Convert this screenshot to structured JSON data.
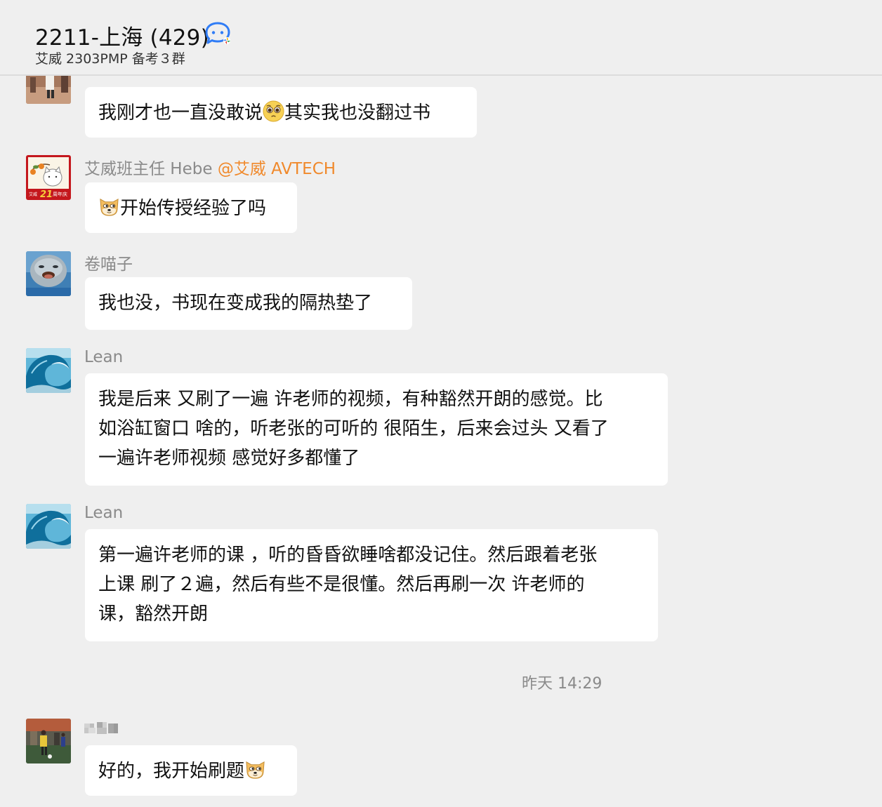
{
  "header": {
    "title": "2211-上海 (429)",
    "subtitle": "艾威 2303PMP 备考３群",
    "group_icon": "chat-bubbles-icon"
  },
  "messages": [
    {
      "sender": "",
      "text_parts": [
        "我刚才也一直没敢说",
        "其实我也没翻过书"
      ],
      "emoji": "pleading-face-icon",
      "avatar": "photo-avatar-person"
    },
    {
      "sender": "艾威班主任 Hebe",
      "mention": "@艾威 AVTECH",
      "text_parts": [
        "",
        "开始传授经验了吗"
      ],
      "emoji": "doge-icon",
      "avatar": "avtech-anniversary-avatar"
    },
    {
      "sender": "卷喵子",
      "text": "我也没，书现在变成我的隔热垫了",
      "avatar": "seal-avatar"
    },
    {
      "sender": "Lean",
      "lines": [
        "我是后来 又刷了一遍 许老师的视频，有种豁然开朗的感觉。比",
        "如浴缸窗口 啥的，听老张的可听的 很陌生，后来会过头 又看了",
        "一遍许老师视频  感觉好多都懂了"
      ],
      "avatar": "wave-avatar"
    },
    {
      "sender": "Lean",
      "lines": [
        "第一遍许老师的课 ，听的昏昏欲睡啥都没记住。然后跟着老张",
        "上课  刷了２遍，然后有些不是很懂。然后再刷一次 许老师的",
        "课，豁然开朗"
      ],
      "avatar": "wave-avatar"
    },
    {
      "sender": "",
      "text_parts": [
        "好的，我开始刷题",
        ""
      ],
      "emoji": "doge-icon",
      "avatar": "photo-avatar-football"
    }
  ],
  "timestamp": "昨天 14:29",
  "avatar_badge": {
    "brand": "艾威",
    "number": "21",
    "text": "周年庆"
  },
  "colors": {
    "background": "#efefef",
    "bubble": "#ffffff",
    "mention": "#f0892b",
    "sender": "#8a8a8a"
  }
}
